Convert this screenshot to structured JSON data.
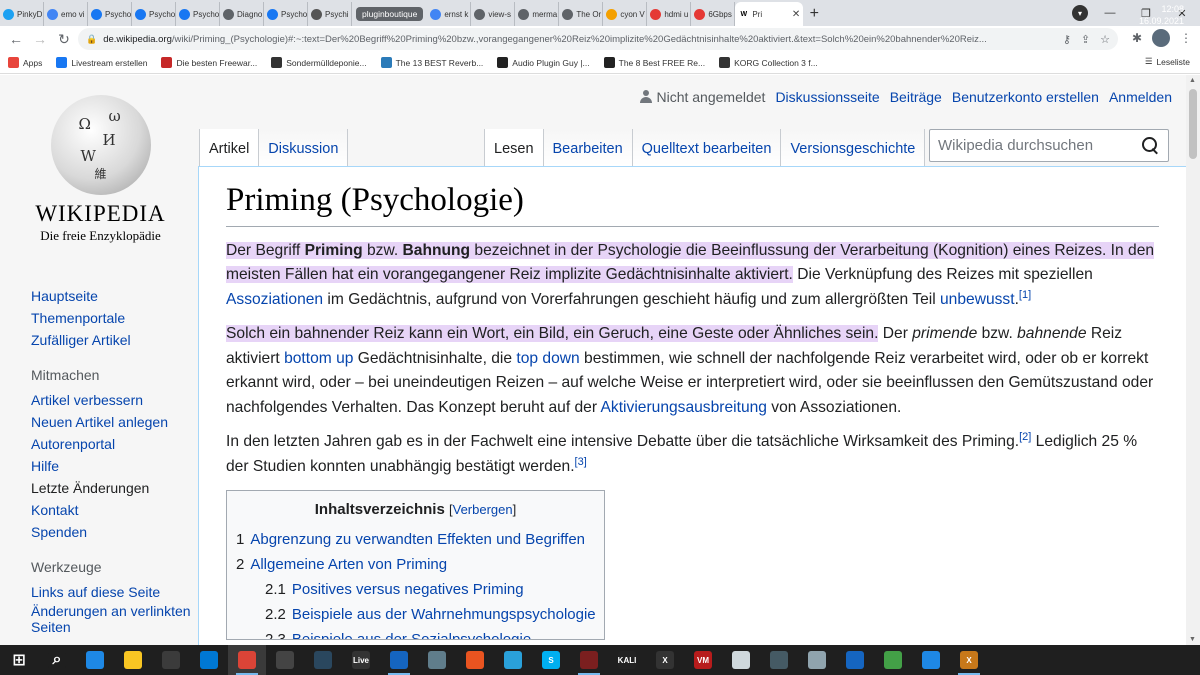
{
  "browser": {
    "tabs": [
      {
        "label": "PinkyD",
        "icon": "twitter-icon",
        "color": "#1da1f2"
      },
      {
        "label": "emo vi",
        "icon": "google-icon",
        "color": "#4285f4"
      },
      {
        "label": "Psycho",
        "icon": "facebook-icon",
        "color": "#1877f2"
      },
      {
        "label": "Psycho",
        "icon": "facebook-icon",
        "color": "#1877f2"
      },
      {
        "label": "Psycho",
        "icon": "facebook-icon",
        "color": "#1877f2"
      },
      {
        "label": "Diagno",
        "icon": "page-icon",
        "color": "#5f6368"
      },
      {
        "label": "Psycho",
        "icon": "facebook-icon",
        "color": "#1877f2"
      },
      {
        "label": "Psychi",
        "icon": "wikipedia-icon",
        "color": "#555555"
      }
    ],
    "group_label": "pluginboutique",
    "tabs2": [
      {
        "label": "ernst k",
        "icon": "google-icon",
        "color": "#4285f4"
      },
      {
        "label": "view-s",
        "icon": "globe-icon",
        "color": "#5f6368"
      },
      {
        "label": "merma",
        "icon": "globe-icon",
        "color": "#5f6368"
      },
      {
        "label": "The Or",
        "icon": "globe-icon",
        "color": "#5f6368"
      },
      {
        "label": "cyon V",
        "icon": "cyon-icon",
        "color": "#f4a000"
      },
      {
        "label": "hdmi u",
        "icon": "store-icon",
        "color": "#e53935"
      },
      {
        "label": "6Gbps",
        "icon": "store-icon",
        "color": "#e53935"
      }
    ],
    "active_tab": {
      "label": "Pri",
      "icon": "wikipedia-icon"
    },
    "new_tab": "+",
    "url_host": "de.wikipedia.org",
    "url_path": "/wiki/Priming_(Psychologie)#:~:text=Der%20Begriff%20Priming%20bzw.,vorangegangener%20Reiz%20implizite%20Gedächtnisinhalte%20aktiviert.&text=Solch%20ein%20bahnender%20Reiz...",
    "bookmarks": [
      {
        "label": "Apps",
        "color": "#e8453c"
      },
      {
        "label": "Livestream erstellen",
        "color": "#1877f2"
      },
      {
        "label": "Die besten Freewar...",
        "color": "#c62828"
      },
      {
        "label": "Sondermülldeponie...",
        "color": "#333333"
      },
      {
        "label": "The 13 BEST Reverb...",
        "color": "#2b7bb9"
      },
      {
        "label": "Audio Plugin Guy |...",
        "color": "#222222"
      },
      {
        "label": "The 8 Best FREE Re...",
        "color": "#222222"
      },
      {
        "label": "KORG Collection 3 f...",
        "color": "#333333"
      }
    ],
    "reading_list": "Leseliste"
  },
  "wiki": {
    "logo_wordmark": "Wikipedia",
    "logo_tagline": "Die freie Enzyklopädie",
    "personal": {
      "not_logged_in": "Nicht angemeldet",
      "talk": "Diskussionsseite",
      "contributions": "Beiträge",
      "create_account": "Benutzerkonto erstellen",
      "login": "Anmelden"
    },
    "tabs_left": [
      "Artikel",
      "Diskussion"
    ],
    "tabs_right": [
      "Lesen",
      "Bearbeiten",
      "Quelltext bearbeiten",
      "Versionsgeschichte"
    ],
    "search_placeholder": "Wikipedia durchsuchen",
    "nav": [
      "Hauptseite",
      "Themenportale",
      "Zufälliger Artikel"
    ],
    "mitmachen_head": "Mitmachen",
    "mitmachen": [
      "Artikel verbessern",
      "Neuen Artikel anlegen",
      "Autorenportal",
      "Hilfe",
      "Letzte Änderungen",
      "Kontakt",
      "Spenden"
    ],
    "werkzeuge_head": "Werkzeuge",
    "werkzeuge": [
      "Links auf diese Seite",
      "Änderungen an verlinkten Seiten"
    ],
    "title": "Priming (Psychologie)",
    "p1": {
      "a": "Der Begriff ",
      "b": "Priming",
      "c": " bzw. ",
      "d": "Bahnung",
      "e": " bezeichnet in der Psychologie die Beeinflussung der Verarbeitung (Kognition) eines Reizes. In den meisten Fällen hat ein vorangegangener Reiz implizite Gedächtnisinhalte aktiviert.",
      "f": " Die Verknüpfung des Reizes mit speziellen ",
      "link1": "Assoziationen",
      "g": " im Gedächtnis, aufgrund von Vorerfahrungen geschieht häufig und zum allergrößten Teil ",
      "link2": "unbewusst",
      "h": ".",
      "ref": "[1]"
    },
    "p2": {
      "a": "Solch ein bahnender Reiz kann ein Wort, ein Bild, ein Geruch, eine Geste oder Ähnliches sein.",
      "b": " Der ",
      "c": "primende",
      "d": " bzw. ",
      "e": "bahnende",
      "f": " Reiz aktiviert ",
      "link1": "bottom up",
      "g": " Gedächtnisinhalte, die ",
      "link2": "top down",
      "h": " bestimmen, wie schnell der nachfolgende Reiz verarbeitet wird, oder ob er korrekt erkannt wird, oder – bei uneindeutigen Reizen – auf welche Weise er interpretiert wird, oder sie beeinflussen den Gemütszustand oder nachfolgendes Verhalten. Das Konzept beruht auf der ",
      "link3": "Aktivierungsausbreitung",
      "i": " von Assoziationen."
    },
    "p3": {
      "a": "In den letzten Jahren gab es in der Fachwelt eine intensive Debatte über die tatsächliche Wirksamkeit des Priming.",
      "ref2": "[2]",
      "b": " Lediglich 25 % der Studien konnten unabhängig bestätigt werden.",
      "ref3": "[3]"
    },
    "toc": {
      "title": "Inhaltsverzeichnis",
      "toggle": "Verbergen",
      "items": [
        {
          "num": "1",
          "label": "Abgrenzung zu verwandten Effekten und Begriffen",
          "level": 1
        },
        {
          "num": "2",
          "label": "Allgemeine Arten von Priming",
          "level": 1
        },
        {
          "num": "2.1",
          "label": "Positives versus negatives Priming",
          "level": 2
        },
        {
          "num": "2.2",
          "label": "Beispiele aus der Wahrnehmungspsychologie",
          "level": 2
        },
        {
          "num": "2.3",
          "label": "Beispiele aus der Sozialpsychologie",
          "level": 2
        }
      ]
    }
  },
  "taskbar": {
    "time": "12:08",
    "date": "16.09.2021",
    "apps": [
      {
        "name": "start-icon",
        "color": "#ffffff",
        "text": ""
      },
      {
        "name": "search-icon",
        "color": "#1f1f1f",
        "text": ""
      },
      {
        "name": "edge-icon",
        "color": "#1e88e5",
        "text": ""
      },
      {
        "name": "explorer-icon",
        "color": "#f9c623",
        "text": ""
      },
      {
        "name": "store-icon",
        "color": "#3b3b3b",
        "text": ""
      },
      {
        "name": "mail-icon",
        "color": "#0078d4",
        "text": ""
      },
      {
        "name": "chrome-icon",
        "color": "#db4437",
        "text": ""
      },
      {
        "name": "app-icon",
        "color": "#444444",
        "text": ""
      },
      {
        "name": "steam-icon",
        "color": "#2a475e",
        "text": ""
      },
      {
        "name": "live-icon",
        "color": "#333333",
        "text": "Live"
      },
      {
        "name": "globe-icon",
        "color": "#1565c0",
        "text": ""
      },
      {
        "name": "app-icon",
        "color": "#607d8b",
        "text": ""
      },
      {
        "name": "ubuntu-icon",
        "color": "#e95420",
        "text": ""
      },
      {
        "name": "telegram-icon",
        "color": "#2aa1da",
        "text": ""
      },
      {
        "name": "skype-icon",
        "color": "#00aff0",
        "text": "S"
      },
      {
        "name": "app-icon",
        "color": "#7b1f1f",
        "text": ""
      },
      {
        "name": "kali-icon",
        "color": "#222222",
        "text": "KALI"
      },
      {
        "name": "x-icon",
        "color": "#333333",
        "text": "X"
      },
      {
        "name": "voicemeeter-icon",
        "color": "#b71c1c",
        "text": "VM"
      },
      {
        "name": "app-icon",
        "color": "#cfd8dc",
        "text": ""
      },
      {
        "name": "app-icon",
        "color": "#455a64",
        "text": ""
      },
      {
        "name": "cube-icon",
        "color": "#90a4ae",
        "text": ""
      },
      {
        "name": "app-icon",
        "color": "#1565c0",
        "text": ""
      },
      {
        "name": "wechat-icon",
        "color": "#43a047",
        "text": ""
      },
      {
        "name": "app-icon",
        "color": "#1e88e5",
        "text": ""
      },
      {
        "name": "x-icon",
        "color": "#c7781a",
        "text": "X"
      }
    ]
  }
}
